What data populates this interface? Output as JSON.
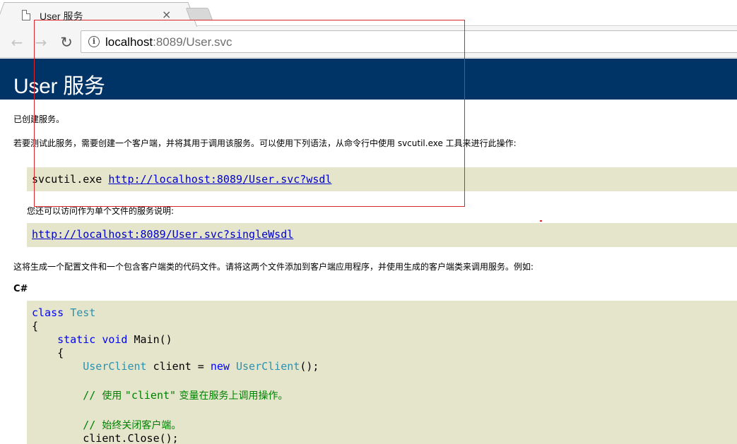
{
  "browser": {
    "tab": {
      "title": "User 服务",
      "close_symbol": "×"
    },
    "nav": {
      "back_symbol": "←",
      "forward_symbol": "→",
      "reload_symbol": "↻"
    },
    "address": {
      "host": "localhost",
      "rest": ":8089/User.svc"
    }
  },
  "page": {
    "heading": "User 服务",
    "p_created": "已创建服务。",
    "p_test": "若要测试此服务，需要创建一个客户端，并将其用于调用该服务。可以使用下列语法，从命令行中使用 svcutil.exe 工具来进行此操作:",
    "svcutil_cmd": "svcutil.exe ",
    "wsdl_url": "http://localhost:8089/User.svc?wsdl",
    "p_single": "您还可以访问作为单个文件的服务说明:",
    "single_wsdl_url": "http://localhost:8089/User.svc?singleWsdl",
    "p_generate": "这将生成一个配置文件和一个包含客户端类的代码文件。请将这两个文件添加到客户端应用程序，并使用生成的客户端类来调用服务。例如:",
    "lang_label": "C#",
    "code": {
      "kw_class": "class",
      "name_test": "Test",
      "brace_open": "{",
      "kw_static_void": "static void",
      "main_sig": " Main()",
      "brace_open_inner": "{",
      "type_userclient": "UserClient",
      "client_assign": " client = ",
      "kw_new": "new",
      "ctor_call": "();",
      "comment_use_prefix": "// ",
      "comment_use_a": "使用 ",
      "comment_use_str": "\"client\"",
      "comment_use_b": " 变量在服务上调用操作。",
      "comment_close_prefix": "// ",
      "comment_close_text": "始终关闭客户端。",
      "close_call": "client.Close();"
    }
  },
  "annotation": {
    "color": "#d9262c"
  },
  "colors": {
    "header_bg": "#003366",
    "code_bg": "#e5e5cc",
    "keyword": "#0000ff",
    "type": "#2b91af",
    "comment": "#008000"
  }
}
